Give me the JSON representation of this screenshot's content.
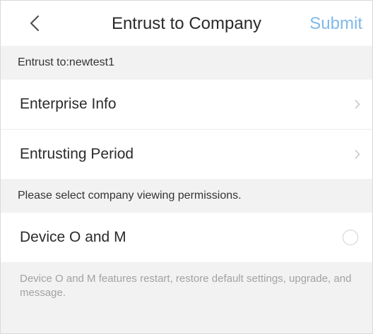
{
  "header": {
    "title": "Entrust to Company",
    "submit_label": "Submit",
    "back_icon": "chevron-left-icon"
  },
  "entrust_to": "Entrust to:newtest1",
  "menu": [
    {
      "label": "Enterprise Info",
      "icon": "chevron-right-icon"
    },
    {
      "label": "Entrusting Period",
      "icon": "chevron-right-icon"
    }
  ],
  "permissions": {
    "prompt": "Please select company viewing permissions.",
    "items": [
      {
        "label": "Device O and M",
        "selected": false
      }
    ],
    "description": "Device O and M features restart, restore default settings, upgrade, and message."
  },
  "colors": {
    "accent": "#7fb9e8",
    "background": "#f2f2f2",
    "row_background": "#ffffff",
    "muted_text": "#a2a2a2"
  }
}
